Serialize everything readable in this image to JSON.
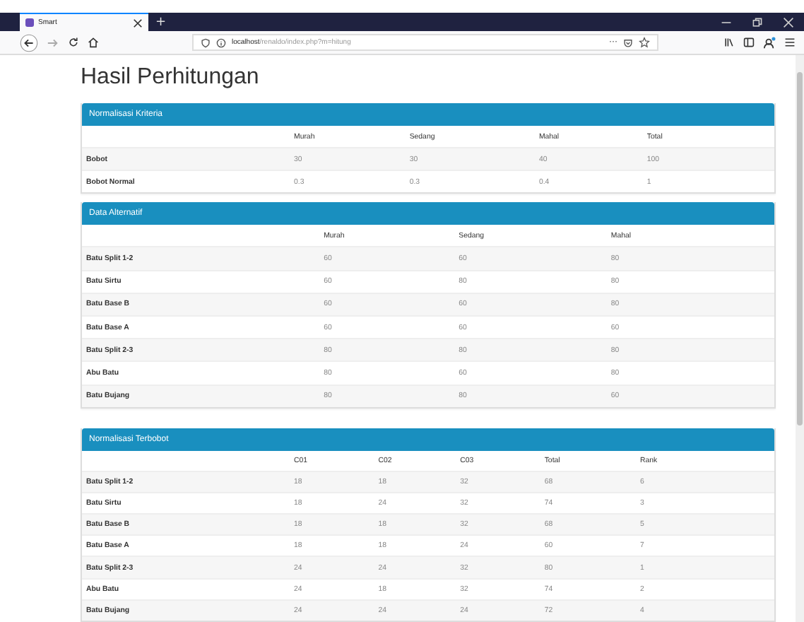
{
  "browser": {
    "tab_title": "Smart",
    "new_tab": "+",
    "url_host": "localhost",
    "url_path": "/renaldo/index.php?m=hitung",
    "page_actions": "···"
  },
  "page": {
    "title": "Hasil Perhitungan"
  },
  "panels": [
    {
      "title": "Normalisasi Kriteria",
      "columns": [
        "Murah",
        "Sedang",
        "Mahal",
        "Total"
      ],
      "rows": [
        {
          "label": "Bobot",
          "cells": [
            "30",
            "30",
            "40",
            "100"
          ]
        },
        {
          "label": "Bobot Normal",
          "cells": [
            "0.3",
            "0.3",
            "0.4",
            "1"
          ]
        }
      ]
    },
    {
      "title": "Data Alternatif",
      "columns": [
        "Murah",
        "Sedang",
        "Mahal"
      ],
      "rows": [
        {
          "label": "Batu Split 1-2",
          "cells": [
            "60",
            "60",
            "80"
          ]
        },
        {
          "label": "Batu Sirtu",
          "cells": [
            "60",
            "80",
            "80"
          ]
        },
        {
          "label": "Batu Base B",
          "cells": [
            "60",
            "60",
            "80"
          ]
        },
        {
          "label": "Batu Base A",
          "cells": [
            "60",
            "60",
            "60"
          ]
        },
        {
          "label": "Batu Split 2-3",
          "cells": [
            "80",
            "80",
            "80"
          ]
        },
        {
          "label": "Abu Batu",
          "cells": [
            "80",
            "60",
            "80"
          ]
        },
        {
          "label": "Batu Bujang",
          "cells": [
            "80",
            "80",
            "60"
          ]
        }
      ]
    },
    {
      "title": "Normalisasi Terbobot",
      "columns": [
        "C01",
        "C02",
        "C03",
        "Total",
        "Rank"
      ],
      "rows": [
        {
          "label": "Batu Split 1-2",
          "cells": [
            "18",
            "18",
            "32",
            "68",
            "6"
          ]
        },
        {
          "label": "Batu Sirtu",
          "cells": [
            "18",
            "24",
            "32",
            "74",
            "3"
          ]
        },
        {
          "label": "Batu Base B",
          "cells": [
            "18",
            "18",
            "32",
            "68",
            "5"
          ]
        },
        {
          "label": "Batu Base A",
          "cells": [
            "18",
            "18",
            "24",
            "60",
            "7"
          ]
        },
        {
          "label": "Batu Split 2-3",
          "cells": [
            "24",
            "24",
            "32",
            "80",
            "1"
          ]
        },
        {
          "label": "Abu Batu",
          "cells": [
            "24",
            "18",
            "32",
            "74",
            "2"
          ]
        },
        {
          "label": "Batu Bujang",
          "cells": [
            "24",
            "24",
            "24",
            "72",
            "4"
          ]
        }
      ]
    }
  ]
}
